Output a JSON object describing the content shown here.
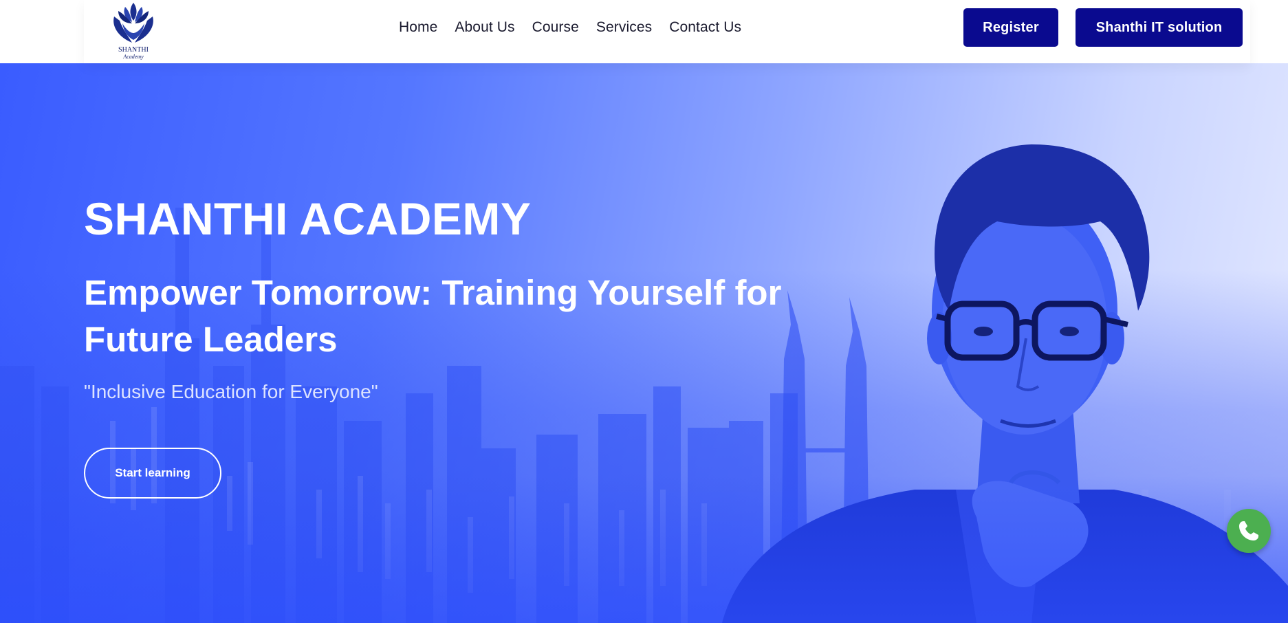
{
  "header": {
    "logo": {
      "name": "SHANTHI",
      "sub": "Academy",
      "icon": "shanthi-academy-logo"
    },
    "nav": [
      {
        "label": "Home"
      },
      {
        "label": "About Us"
      },
      {
        "label": "Course"
      },
      {
        "label": "Services"
      },
      {
        "label": "Contact Us"
      }
    ],
    "register_label": "Register",
    "shanthi_it_label": "Shanthi IT solution"
  },
  "hero": {
    "title": "SHANTHI ACADEMY",
    "subtitle": "Empower Tomorrow: Training Yourself for Future Leaders",
    "quote": "\"Inclusive Education for Everyone\"",
    "cta_label": "Start learning"
  },
  "floating": {
    "whatsapp_icon": "whatsapp-phone-icon"
  },
  "colors": {
    "brand_dark": "#0a0a8f",
    "hero_blue": "#3a5cff",
    "whatsapp_green": "#4caf50"
  }
}
